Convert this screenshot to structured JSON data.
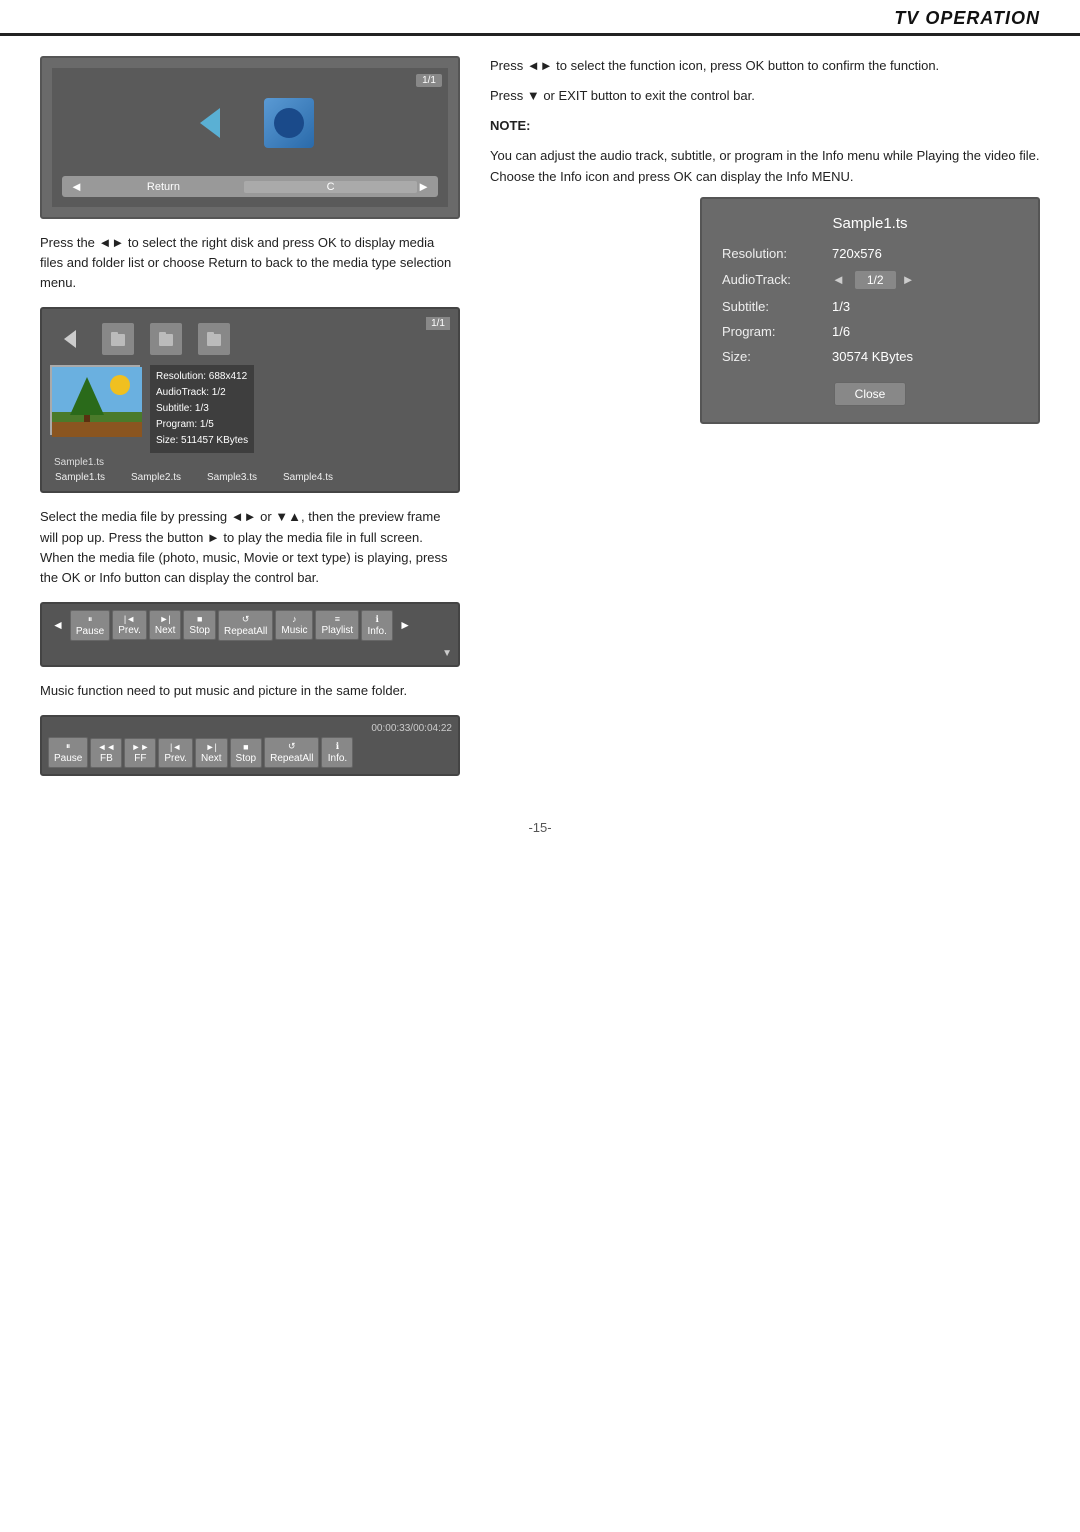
{
  "header": {
    "title": "TV OPERATION"
  },
  "left_col": {
    "disk_browser": {
      "counter": "1/1",
      "nav_label": "Return",
      "nav_c_label": "C"
    },
    "para1": "Press the ◄► to select the right disk and press OK to display media files and folder list or choose Return to back to the media type selection menu.",
    "file_browser": {
      "counter": "1/1",
      "info_lines": [
        "Resolution: 688x412",
        "AudioTrack: 1/2",
        "Subtitle:    1/3",
        "Program:    1/5",
        "Size:  511457 KBytes"
      ],
      "file_labels": [
        "Sample1.ts",
        "Sample2.ts",
        "Sample3.ts",
        "Sample4.ts"
      ]
    },
    "para2": "Select the media file by pressing ◄► or ▼▲, then the preview frame will pop up. Press the button ► to play the media file in full screen. When the media file (photo, music, Movie or text type) is playing, press the OK or Info button can display the control bar.",
    "ctrl_bar": {
      "buttons": [
        {
          "icon": "⏸",
          "label": "Pause"
        },
        {
          "icon": "|◄",
          "label": "Prev."
        },
        {
          "icon": "►|",
          "label": "Next"
        },
        {
          "icon": "■",
          "label": "Stop"
        },
        {
          "icon": "↺",
          "label": "RepeatAll"
        },
        {
          "icon": "♪",
          "label": "Music"
        },
        {
          "icon": "≡",
          "label": "Playlist"
        },
        {
          "icon": "ℹ",
          "label": "Info."
        }
      ]
    },
    "para3": "Music function need to put music and picture in the same folder.",
    "video_ctrl_bar": {
      "timestamp": "00:00:33/00:04:22",
      "buttons": [
        {
          "icon": "⏸",
          "label": "Pause"
        },
        {
          "icon": "◄◄",
          "label": "FB"
        },
        {
          "icon": "►►",
          "label": "FF"
        },
        {
          "icon": "|◄",
          "label": "Prev."
        },
        {
          "icon": "►|",
          "label": "Next"
        },
        {
          "icon": "■",
          "label": "Stop"
        },
        {
          "icon": "↺",
          "label": "RepeatAll"
        },
        {
          "icon": "ℹ",
          "label": "Info."
        }
      ]
    }
  },
  "right_col": {
    "para1": "Press ◄► to select the function icon, press OK button to confirm  the function.",
    "para2": "Press ▼ or EXIT button to exit the control bar.",
    "note_label": "NOTE:",
    "note_text": "You can adjust the audio track, subtitle, or program in the Info menu while Playing the video file. Choose the Info icon and press OK can display the Info MENU.",
    "info_panel": {
      "title": "Sample1.ts",
      "rows": [
        {
          "key": "Resolution:",
          "val": "720x576",
          "has_box": false
        },
        {
          "key": "AudioTrack:",
          "val": "1/2",
          "has_box": true
        },
        {
          "key": "Subtitle:",
          "val": "1/3",
          "has_box": false
        },
        {
          "key": "Program:",
          "val": "1/6",
          "has_box": false
        },
        {
          "key": "Size:",
          "val": "30574 KBytes",
          "has_box": false
        }
      ],
      "close_btn": "Close"
    }
  },
  "page_number": "-15-"
}
